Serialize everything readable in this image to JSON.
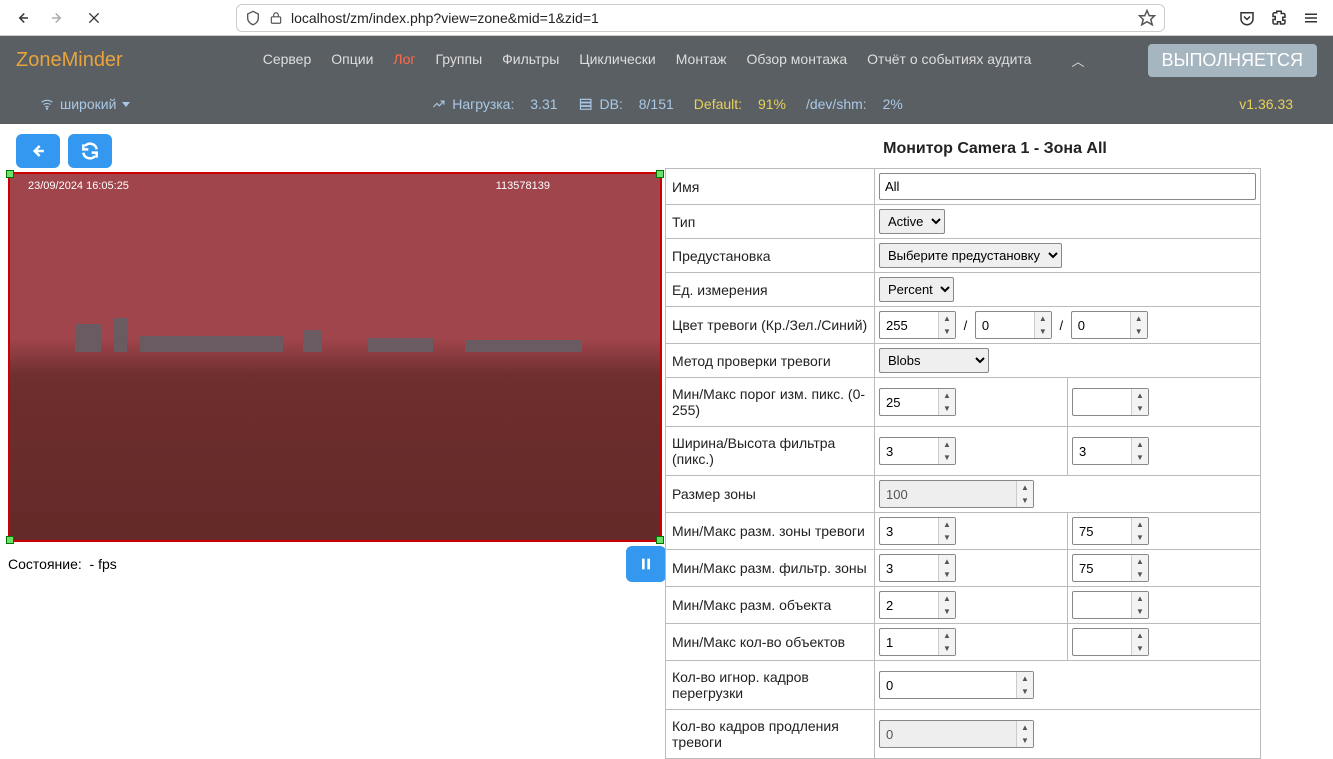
{
  "browser": {
    "url": "localhost/zm/index.php?view=zone&mid=1&zid=1"
  },
  "app": {
    "brand": "ZoneMinder",
    "run_badge": "ВЫПОЛНЯЕТСЯ",
    "nav": {
      "server": "Сервер",
      "options": "Опции",
      "log": "Лог",
      "groups": "Группы",
      "filters": "Фильтры",
      "cycle": "Циклически",
      "montage": "Монтаж",
      "review": "Обзор монтажа",
      "audit": "Отчёт о событиях аудита"
    }
  },
  "status": {
    "bandwidth": "широкий",
    "load_label": "Нагрузка:",
    "load_val": "3.31",
    "db_label": "DB:",
    "db_val": "8/151",
    "default_label": "Default:",
    "default_val": "91%",
    "shm_label": "/dev/shm:",
    "shm_val": "2%",
    "version": "v1.36.33"
  },
  "page": {
    "title": "Монитор Camera 1 - Зона All",
    "state_label": "Состояние:",
    "state_val": "-  fps",
    "preview": {
      "ts": "23/09/2024 16:05:25",
      "frame": "113578139"
    }
  },
  "form": {
    "name": {
      "label": "Имя",
      "value": "All"
    },
    "type": {
      "label": "Тип",
      "value": "Active"
    },
    "preset": {
      "label": "Предустановка",
      "value": "Выберите предустановку"
    },
    "units": {
      "label": "Ед. измерения",
      "value": "Percent"
    },
    "alarm_color": {
      "label": "Цвет тревоги (Кр./Зел./Синий)",
      "r": "255",
      "g": "0",
      "b": "0"
    },
    "check_method": {
      "label": "Метод проверки тревоги",
      "value": "Blobs"
    },
    "pixel_thresh": {
      "label": "Мин/Макс порог изм. пикс. (0-255)",
      "min": "25",
      "max": ""
    },
    "filter_wh": {
      "label": "Ширина/Высота фильтра (пикс.)",
      "w": "3",
      "h": "3"
    },
    "zone_area": {
      "label": "Размер зоны",
      "value": "100"
    },
    "alarm_area": {
      "label": "Мин/Макс разм. зоны тревоги",
      "min": "3",
      "max": "75"
    },
    "filter_area": {
      "label": "Мин/Макс разм. фильтр. зоны",
      "min": "3",
      "max": "75"
    },
    "blob_area": {
      "label": "Мин/Макс разм. объекта",
      "min": "2",
      "max": ""
    },
    "blobs": {
      "label": "Мин/Макс кол-во объектов",
      "min": "1",
      "max": ""
    },
    "overload": {
      "label": "Кол-во игнор. кадров перегрузки",
      "value": "0"
    },
    "extend": {
      "label": "Кол-во кадров продления тревоги",
      "value": "0"
    }
  }
}
